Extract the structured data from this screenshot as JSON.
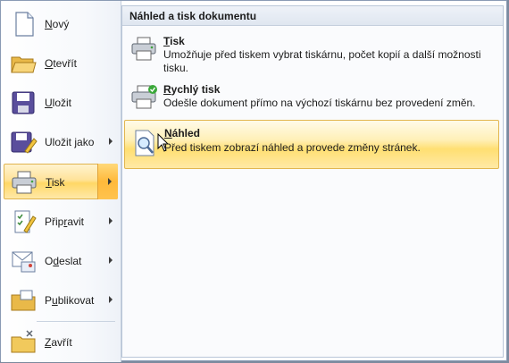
{
  "menu": {
    "items": [
      {
        "name": "menu-item-novy",
        "label_pre": "",
        "label_ul": "N",
        "label_post": "ový",
        "icon": "new-document-icon",
        "submenu": false
      },
      {
        "name": "menu-item-otevrit",
        "label_pre": "",
        "label_ul": "O",
        "label_post": "tevřít",
        "icon": "open-folder-icon",
        "submenu": false
      },
      {
        "name": "menu-item-ulozit",
        "label_pre": "",
        "label_ul": "U",
        "label_post": "ložit",
        "icon": "save-disk-icon",
        "submenu": false
      },
      {
        "name": "menu-item-ulozit-jako",
        "label_pre": "Uložit ",
        "label_ul": "j",
        "label_post": "ako",
        "icon": "save-as-icon",
        "submenu": true
      },
      {
        "name": "menu-item-tisk",
        "label_pre": "",
        "label_ul": "T",
        "label_post": "isk",
        "icon": "printer-icon",
        "submenu": true,
        "selected": true
      },
      {
        "name": "menu-item-pripravit",
        "label_pre": "Přip",
        "label_ul": "r",
        "label_post": "avit",
        "icon": "prepare-icon",
        "submenu": true
      },
      {
        "name": "menu-item-odeslat",
        "label_pre": "O",
        "label_ul": "d",
        "label_post": "eslat",
        "icon": "send-icon",
        "submenu": true
      },
      {
        "name": "menu-item-publikovat",
        "label_pre": "P",
        "label_ul": "u",
        "label_post": "blikovat",
        "icon": "publish-icon",
        "submenu": true
      },
      {
        "name": "menu-item-zavrit",
        "label_pre": "",
        "label_ul": "Z",
        "label_post": "avřít",
        "icon": "close-folder-icon",
        "submenu": false
      }
    ]
  },
  "submenu": {
    "header": "Náhled a tisk dokumentu",
    "items": [
      {
        "title_ul": "T",
        "title_rest": "isk",
        "description": "Umožňuje před tiskem vybrat tiskárnu, počet kopií a další možnosti tisku.",
        "icon": "printer-icon"
      },
      {
        "title_ul": "R",
        "title_rest": "ychlý tisk",
        "description": "Odešle dokument přímo na výchozí tiskárnu bez provedení změn.",
        "icon": "quick-print-icon"
      },
      {
        "title_ul": "N",
        "title_rest": "áhled",
        "description": "Před tiskem zobrazí náhled a provede změny stránek.",
        "icon": "print-preview-icon",
        "hover": true
      }
    ]
  },
  "colors": {
    "accent": "#ffd766",
    "border": "#8a9bb4"
  }
}
